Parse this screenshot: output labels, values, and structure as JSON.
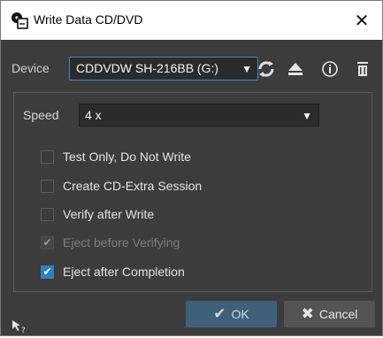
{
  "window": {
    "title": "Write Data CD/DVD",
    "close_glyph": "✕"
  },
  "device": {
    "label": "Device",
    "selected": "CDDVDW SH-216BB (G:)",
    "caret": "▼",
    "tools": [
      "refresh-icon",
      "eject-icon",
      "info-icon",
      "trash-icon"
    ]
  },
  "speed": {
    "label": "Speed",
    "selected": "4 x",
    "caret": "▼"
  },
  "options": [
    {
      "label": "Test Only, Do Not Write",
      "checked": false,
      "enabled": true
    },
    {
      "label": "Create CD-Extra Session",
      "checked": false,
      "enabled": true
    },
    {
      "label": "Verify after Write",
      "checked": false,
      "enabled": true
    },
    {
      "label": "Eject before Verifying",
      "checked": true,
      "enabled": false
    },
    {
      "label": "Eject after Completion",
      "checked": true,
      "enabled": true
    }
  ],
  "buttons": {
    "ok_label": "OK",
    "ok_glyph": "✔",
    "cancel_label": "Cancel",
    "cancel_glyph": "✖"
  },
  "colors": {
    "accent": "#3d89c9",
    "background": "#3c3c3c"
  }
}
